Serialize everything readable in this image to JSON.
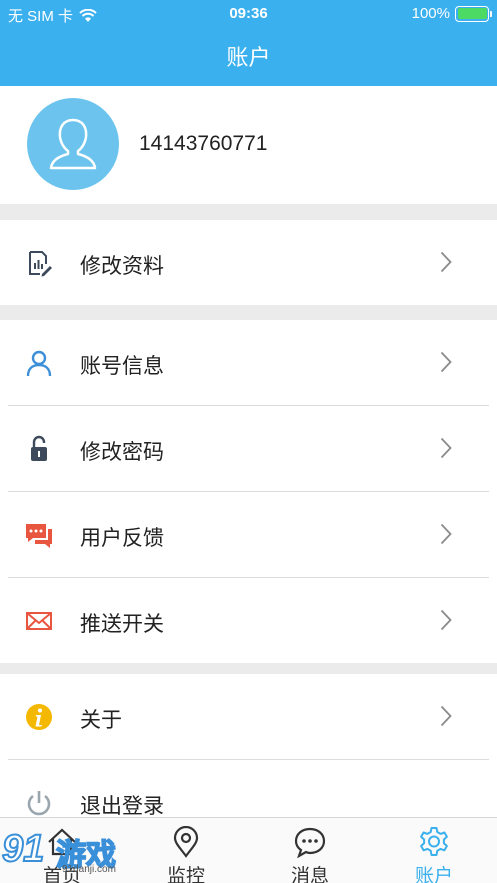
{
  "status_bar": {
    "carrier": "无 SIM 卡",
    "time": "09:36",
    "battery": "100%"
  },
  "nav": {
    "title": "账户"
  },
  "profile": {
    "phone": "14143760771"
  },
  "menu": {
    "edit_profile": "修改资料",
    "account_info": "账号信息",
    "change_password": "修改密码",
    "feedback": "用户反馈",
    "push_switch": "推送开关",
    "about": "关于",
    "logout": "退出登录"
  },
  "tabs": [
    {
      "label": "首页",
      "icon": "home-icon"
    },
    {
      "label": "监控",
      "icon": "location-pin-icon"
    },
    {
      "label": "消息",
      "icon": "chat-bubble-icon"
    },
    {
      "label": "账户",
      "icon": "gear-icon"
    }
  ],
  "watermark": {
    "number": "91",
    "text": "游戏",
    "url": "91danji.com"
  },
  "colors": {
    "accent": "#3bb0ee",
    "avatar_bg": "#6cc4ee",
    "feedback_red": "#e8563f",
    "about_yellow": "#f5b800",
    "battery_green": "#4cd964"
  }
}
